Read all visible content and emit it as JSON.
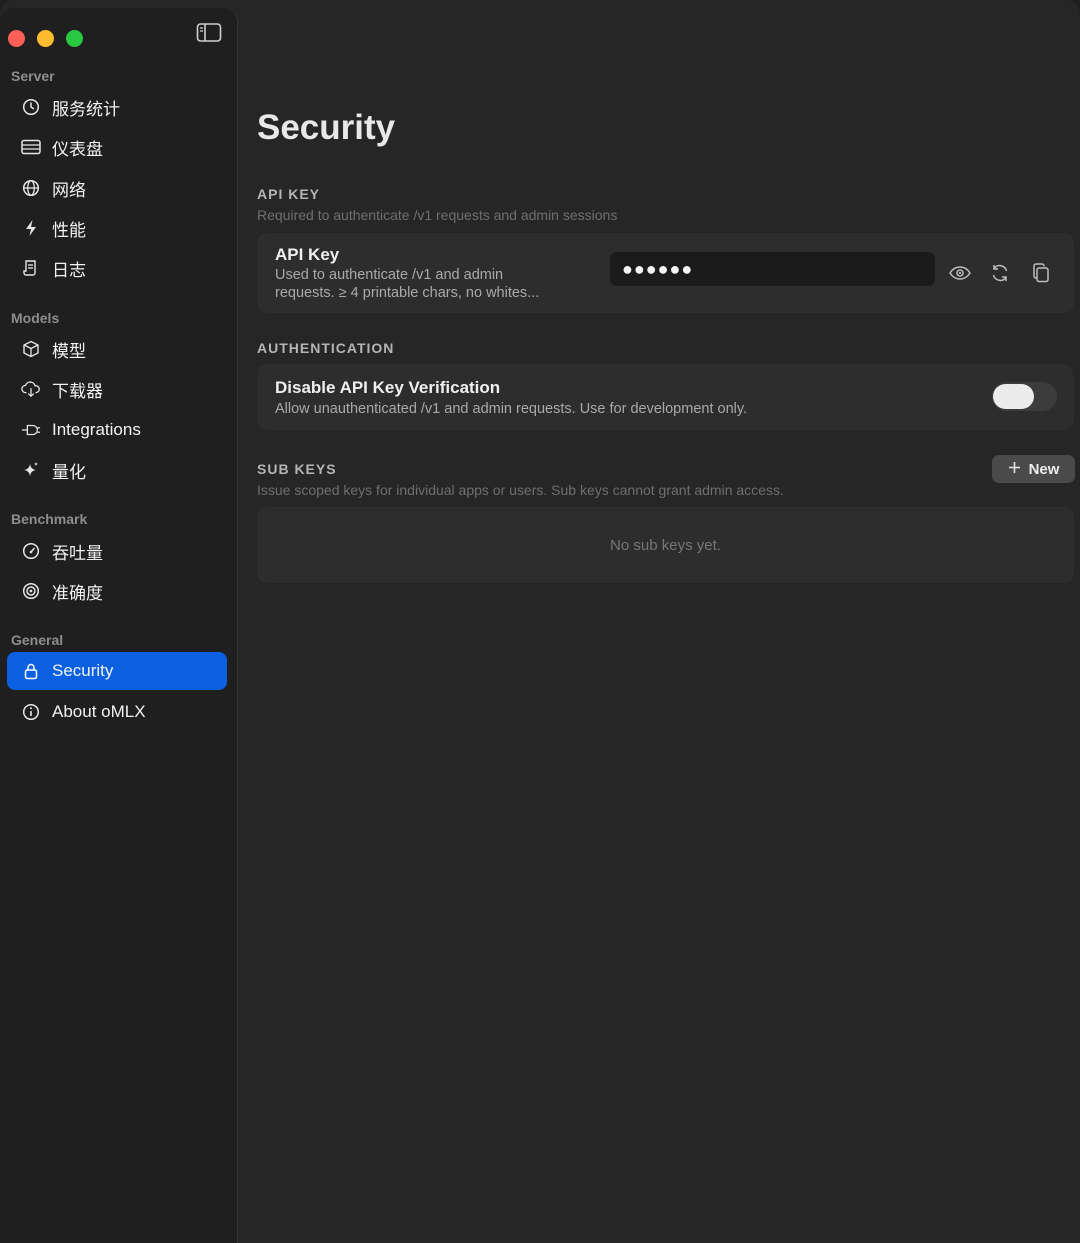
{
  "colors": {
    "accent": "#0a60e0",
    "close": "#fe5f57",
    "minimize": "#febc2e",
    "zoom": "#28c840"
  },
  "sidebar": {
    "toggle_icon": "sidebar-toggle-icon",
    "sections": [
      {
        "title": "Server",
        "items": [
          {
            "label": "服务统计",
            "icon": "clock-icon"
          },
          {
            "label": "仪表盘",
            "icon": "server-rack-icon"
          },
          {
            "label": "网络",
            "icon": "globe-icon"
          },
          {
            "label": "性能",
            "icon": "bolt-icon"
          },
          {
            "label": "日志",
            "icon": "scroll-icon"
          }
        ]
      },
      {
        "title": "Models",
        "items": [
          {
            "label": "模型",
            "icon": "cube-icon"
          },
          {
            "label": "下载器",
            "icon": "cloud-download-icon"
          },
          {
            "label": "Integrations",
            "icon": "plug-icon"
          },
          {
            "label": "量化",
            "icon": "sparkle-icon"
          }
        ]
      },
      {
        "title": "Benchmark",
        "items": [
          {
            "label": "吞吐量",
            "icon": "gauge-icon"
          },
          {
            "label": "准确度",
            "icon": "target-icon"
          }
        ]
      },
      {
        "title": "General",
        "items": [
          {
            "label": "Security",
            "icon": "lock-icon",
            "active": true
          },
          {
            "label": "About oMLX",
            "icon": "info-icon"
          }
        ]
      }
    ]
  },
  "main": {
    "title": "Security",
    "api_key_section": {
      "label": "API KEY",
      "description": "Required to authenticate /v1 requests and admin sessions",
      "row_title": "API Key",
      "row_desc_line1": "Used to authenticate /v1 and admin",
      "row_desc_line2": "requests. ≥ 4 printable chars, no whites...",
      "masked_value": "●●●●●●"
    },
    "auth_section": {
      "label": "AUTHENTICATION",
      "row_title": "Disable API Key Verification",
      "row_desc": "Allow unauthenticated /v1 and admin requests. Use for development only.",
      "toggle_on": false
    },
    "sub_keys_section": {
      "label": "SUB KEYS",
      "description": "Issue scoped keys for individual apps or users. Sub keys cannot grant admin access.",
      "new_button": "New",
      "empty_text": "No sub keys yet."
    }
  }
}
